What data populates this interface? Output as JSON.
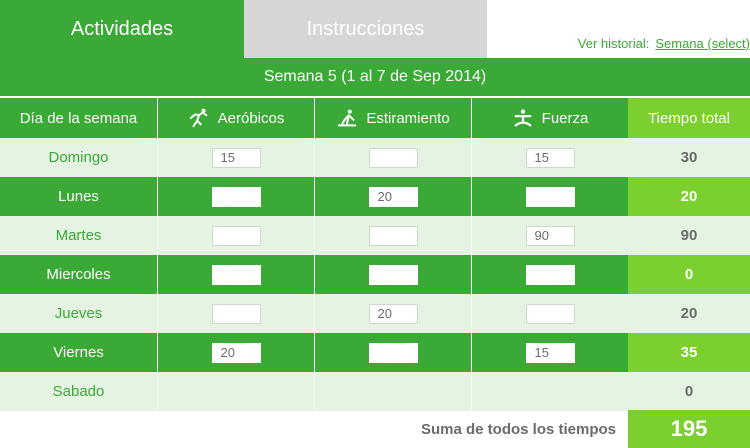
{
  "tabs": {
    "activities": "Actividades",
    "instructions": "Instrucciones"
  },
  "history": {
    "label": "Ver historial:",
    "link": "Semana (select)"
  },
  "week_title": "Semana 5 (1 al 7 de Sep 2014)",
  "columns": {
    "day": "Día de la semana",
    "aerobic": "Aeróbicos",
    "stretch": "Estiramiento",
    "strength": "Fuerza",
    "total": "Tiempo total"
  },
  "rows": [
    {
      "day": "Domingo",
      "aerobic": "15",
      "stretch": "",
      "strength": "15",
      "total": "30"
    },
    {
      "day": "Lunes",
      "aerobic": "",
      "stretch": "20",
      "strength": "",
      "total": "20"
    },
    {
      "day": "Martes",
      "aerobic": "",
      "stretch": "",
      "strength": "90",
      "total": "90"
    },
    {
      "day": "Miercoles",
      "aerobic": "",
      "stretch": "",
      "strength": "",
      "total": "0"
    },
    {
      "day": "Jueves",
      "aerobic": "",
      "stretch": "20",
      "strength": "",
      "total": "20"
    },
    {
      "day": "Viernes",
      "aerobic": "20",
      "stretch": "",
      "strength": "15",
      "total": "35"
    },
    {
      "day": "Sabado",
      "aerobic": "",
      "stretch": "",
      "strength": "",
      "total": "0"
    }
  ],
  "summary": {
    "label": "Suma de todos los tiempos",
    "value": "195"
  },
  "icons": {
    "aerobic": "runner-icon",
    "stretch": "stretch-icon",
    "strength": "weightlifter-icon"
  },
  "colors": {
    "primary_green": "#3aa935",
    "accent_green": "#7bcf2f",
    "light_row": "#e5f3e2",
    "inactive_tab": "#d6d6d6"
  }
}
